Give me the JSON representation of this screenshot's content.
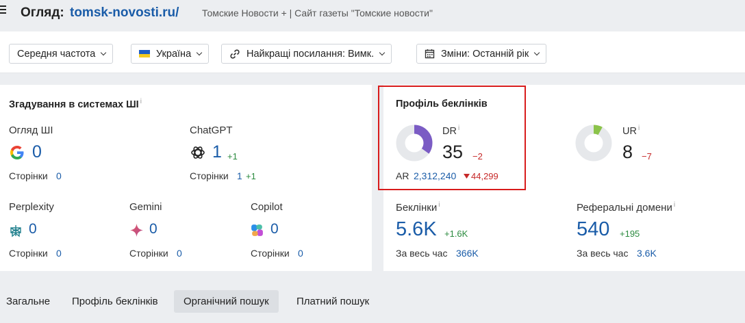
{
  "header": {
    "title_prefix": "Огляд:",
    "title_domain": "tomsk-novosti.ru/",
    "subtitle": "Томские Новости + | Сайт газеты \"Томские новости\""
  },
  "filters": {
    "volume": "Середня частота",
    "country": "Україна",
    "best_links": "Найкращі посилання: Вимк.",
    "changes": "Зміни: Останній рік"
  },
  "ai_mentions": {
    "title": "Згадування в системах ШІ",
    "info": "i",
    "overview": {
      "label": "Огляд ШІ",
      "value": "0",
      "pages_label": "Сторінки",
      "pages_value": "0"
    },
    "chatgpt": {
      "label": "ChatGPT",
      "value": "1",
      "delta": "+1",
      "pages_label": "Сторінки",
      "pages_value": "1",
      "pages_delta": "+1"
    },
    "perplexity": {
      "label": "Perplexity",
      "value": "0",
      "pages_label": "Сторінки",
      "pages_value": "0"
    },
    "gemini": {
      "label": "Gemini",
      "value": "0",
      "pages_label": "Сторінки",
      "pages_value": "0"
    },
    "copilot": {
      "label": "Copilot",
      "value": "0",
      "pages_label": "Сторінки",
      "pages_value": "0"
    }
  },
  "backlink_profile": {
    "title": "Профіль беклінків",
    "dr": {
      "label": "DR",
      "info": "i",
      "value": "35",
      "delta": "−2",
      "gauge_fraction": 0.35
    },
    "ar": {
      "label": "AR",
      "value": "2,312,240",
      "delta": "44,299"
    },
    "ur": {
      "label": "UR",
      "info": "i",
      "value": "8",
      "delta": "−7",
      "gauge_fraction": 0.08
    },
    "backlinks": {
      "label": "Беклінки",
      "info": "i",
      "value": "5.6K",
      "delta": "+1.6K",
      "all_time_label": "За весь час",
      "all_time_value": "366K"
    },
    "ref_domains": {
      "label": "Реферальні домени",
      "info": "i",
      "value": "540",
      "delta": "+195",
      "all_time_label": "За весь час",
      "all_time_value": "3.6K"
    }
  },
  "tabs": [
    {
      "label": "Загальне",
      "active": false
    },
    {
      "label": "Профіль беклінків",
      "active": false
    },
    {
      "label": "Органічний пошук",
      "active": true
    },
    {
      "label": "Платний пошук",
      "active": false
    }
  ],
  "colors": {
    "accent_blue": "#1a5ca8",
    "dr_gauge": "#7b5cc4",
    "ur_gauge": "#8bc34a",
    "gauge_track": "#e6e8eb",
    "highlight": "#d81b1b",
    "positive": "#2a8a3e",
    "negative": "#c62828"
  }
}
